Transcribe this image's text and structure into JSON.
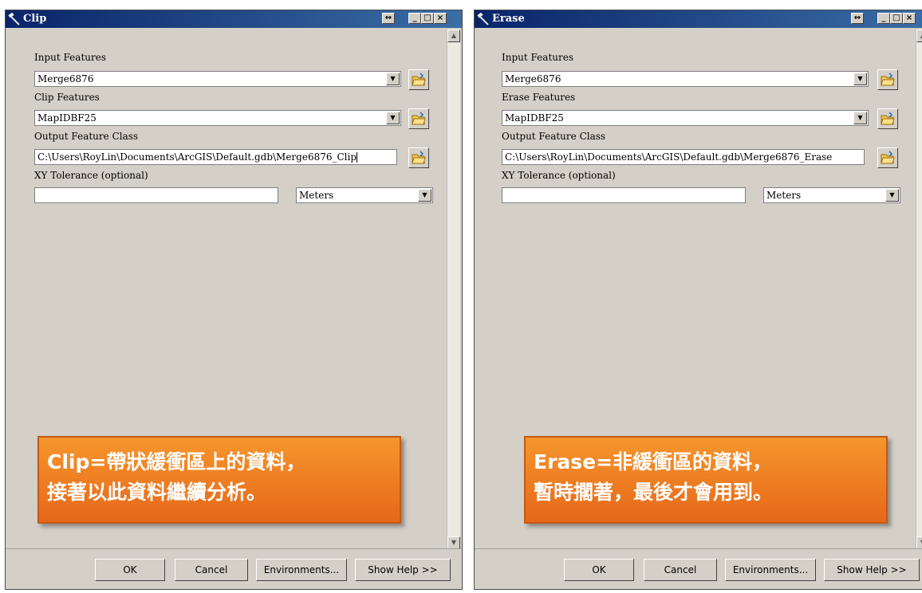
{
  "clip_window": {
    "title": "Clip",
    "input_features_label": "Input Features",
    "input_features_value": "Merge6876",
    "clip_features_label": "Clip Features",
    "clip_features_value": "MapIDBF25",
    "output_label": "Output Feature Class",
    "output_value": "C:\\Users\\RoyLin\\Documents\\ArcGIS\\Default.gdb\\Merge6876_Clip",
    "xy_label": "XY Tolerance (optional)",
    "xy_value": "",
    "units_value": "Meters",
    "callout_line1": "Clip=帶狀緩衝區上的資料，",
    "callout_line2": "接著以此資料繼續分析。",
    "buttons": {
      "ok": "OK",
      "cancel": "Cancel",
      "environments": "Environments...",
      "help": "Show Help >>"
    }
  },
  "erase_window": {
    "title": "Erase",
    "input_features_label": "Input Features",
    "input_features_value": "Merge6876",
    "erase_features_label": "Erase Features",
    "erase_features_value": "MapIDBF25",
    "output_label": "Output Feature Class",
    "output_value": "C:\\Users\\RoyLin\\Documents\\ArcGIS\\Default.gdb\\Merge6876_Erase",
    "xy_label": "XY Tolerance (optional)",
    "xy_value": "",
    "units_value": "Meters",
    "callout_line1": "Erase=非緩衝區的資料，",
    "callout_line2": "暫時擱著，最後才會用到。",
    "buttons": {
      "ok": "OK",
      "cancel": "Cancel",
      "environments": "Environments...",
      "help": "Show Help >>"
    }
  },
  "icons": {
    "title": "tool-hammer-icon",
    "browse": "open-folder-icon",
    "dropdown": "chevron-down-icon"
  },
  "colors": {
    "titlebar": "#0a246a",
    "dialog": "#d4d0c8",
    "callout": "#f0822a"
  }
}
